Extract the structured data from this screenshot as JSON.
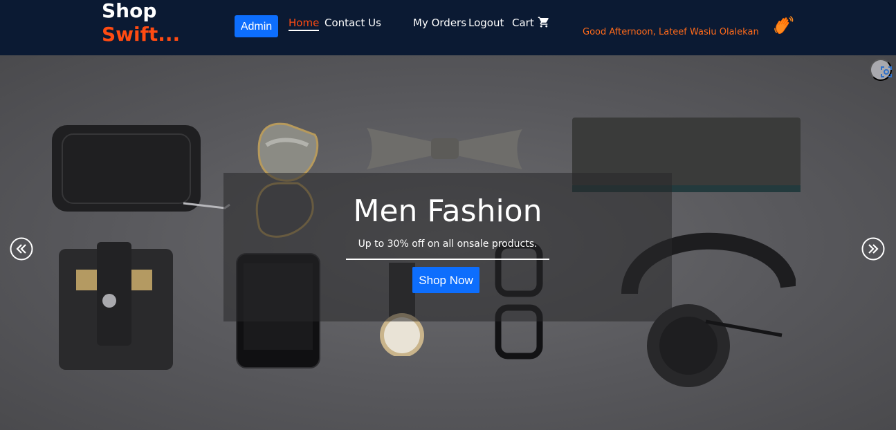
{
  "brand": {
    "line1": "Shop",
    "line2": "Swift..."
  },
  "nav": {
    "admin_label": "Admin",
    "home_label": "Home",
    "contact_label": "Contact Us",
    "orders_label": "My Orders",
    "logout_label": "Logout",
    "cart_label": "Cart"
  },
  "greeting": "Good Afternoon, Lateef Wasiu Olalekan",
  "hero": {
    "title": "Men Fashion",
    "subtitle": "Up to 30% off on all onsale products.",
    "cta_label": "Shop Now"
  },
  "icons": {
    "cart": "cart-icon",
    "wave": "waving-hand-icon",
    "prev": "chevrons-left-icon",
    "next": "chevrons-right-icon",
    "scan": "scan-icon"
  },
  "colors": {
    "header_bg": "#0b1a33",
    "accent_orange": "#ff4b12",
    "button_blue": "#0d6efd"
  }
}
